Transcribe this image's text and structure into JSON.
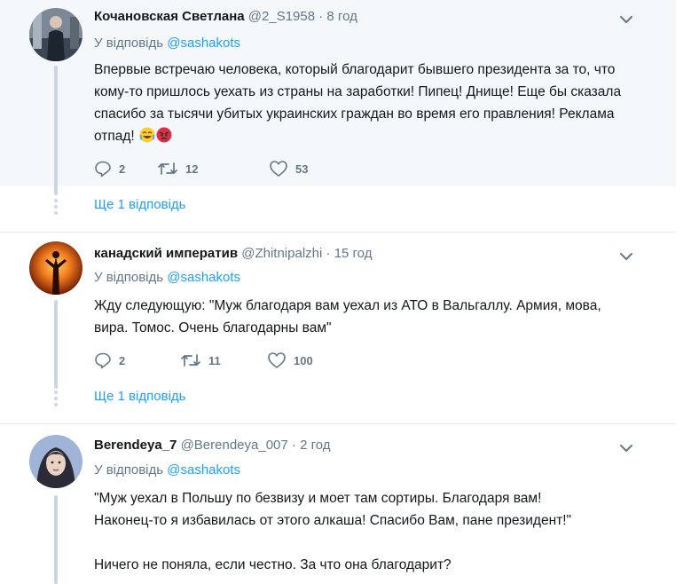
{
  "tweets": [
    {
      "name": "Кочановская Светлана",
      "handle": "@2_S1958",
      "separator": "·",
      "time": "8 год",
      "reply_prefix": "У відповідь",
      "reply_user": "@sashakots",
      "text": "Впервые встречаю человека, который благодарит бывшего президента за то, что кому-то пришлось уехать из страны на заработки! Пипец! Днище! Еще бы сказала спасибо за тысячи убитых украинских граждан во время его правления! Реклама отпад!",
      "emojis": [
        "face-with-tears-of-joy-emoji",
        "angry-face-emoji"
      ],
      "replies": "2",
      "retweets": "12",
      "likes": "53",
      "more_replies": "Ще 1 відповідь"
    },
    {
      "name": "канадский императив",
      "handle": "@Zhitnipalzhi",
      "separator": "·",
      "time": "15 год",
      "reply_prefix": "У відповідь",
      "reply_user": "@sashakots",
      "text": "Жду следующую: \"Муж благодаря вам уехал из АТО в Вальгаллу. Армия, мова, вира. Томос. Очень благодарны вам\"",
      "replies": "2",
      "retweets": "11",
      "likes": "100",
      "more_replies": "Ще 1 відповідь"
    },
    {
      "name": "Berendeya_7",
      "handle": "@Berendeya_007",
      "separator": "·",
      "time": "2 год",
      "reply_prefix": "У відповідь",
      "reply_user": "@sashakots",
      "text_line1": "\"Муж уехал в Польшу по безвизу и моет там сортиры. Благодаря вам!",
      "text_line2": "Наконец-то я избавилась от этого алкаша! Спасибо Вам, пане президент!\"",
      "text_line3": "Ничего не поняла, если честно. За что она благодарит?"
    }
  ],
  "icons": {
    "reply": "reply-icon",
    "retweet": "retweet-icon",
    "like": "heart-icon",
    "more": "chevron-down-icon"
  },
  "colors": {
    "link": "#1da1f2",
    "secondary_text": "#657786",
    "highlight_bg": "#f5f8fa",
    "thread_line": "#ccd6dd"
  }
}
